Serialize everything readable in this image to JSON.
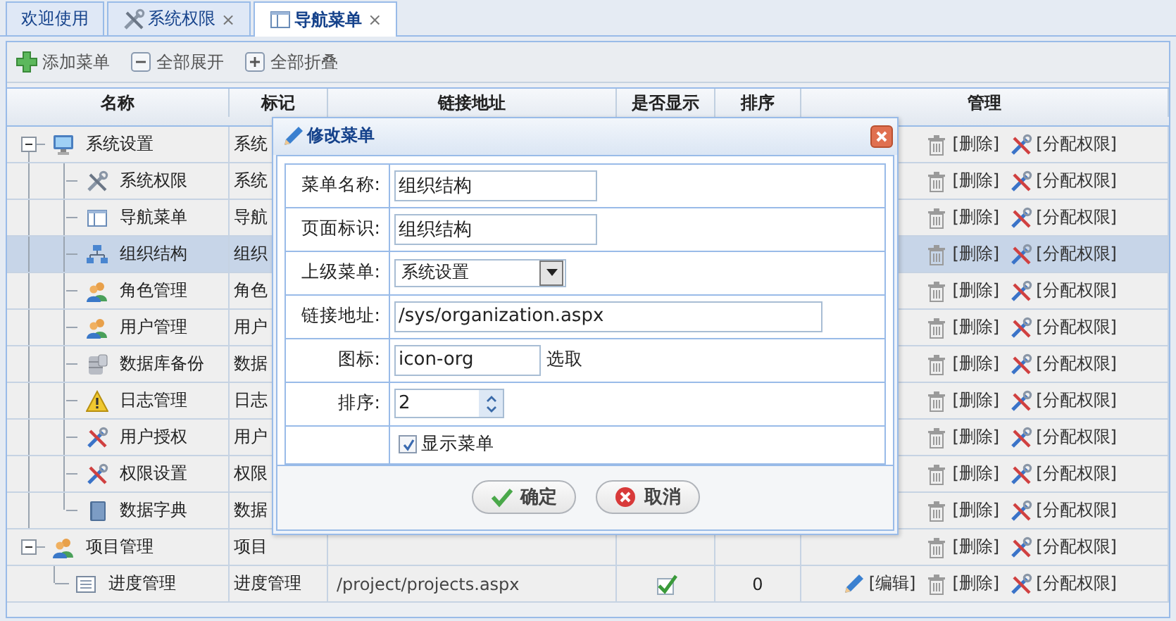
{
  "tabs": [
    {
      "label": "欢迎使用",
      "selected": false
    },
    {
      "label": "系统权限",
      "selected": false,
      "close": "×"
    },
    {
      "label": "导航菜单",
      "selected": true,
      "close": "×"
    }
  ],
  "toolbar": [
    {
      "label": "添加菜单"
    },
    {
      "label": "全部展开"
    },
    {
      "label": "全部折叠"
    }
  ],
  "table": {
    "columns": [
      "名称",
      "标记",
      "链接地址",
      "是否显示",
      "排序",
      "管理"
    ],
    "tree": [
      {
        "name": "系统设置",
        "mark": "系统",
        "expanded": true,
        "selected": false,
        "actions": [
          {
            "kind": "delete",
            "label": "[删除]"
          },
          {
            "kind": "assign",
            "label": "[分配权限]"
          }
        ],
        "children": [
          {
            "name": "系统权限",
            "mark": "系统",
            "selected": false,
            "actions": [
              {
                "kind": "delete",
                "label": "[删除]"
              },
              {
                "kind": "assign",
                "label": "[分配权限]"
              }
            ]
          },
          {
            "name": "导航菜单",
            "mark": "导航",
            "selected": false,
            "actions": [
              {
                "kind": "delete",
                "label": "[删除]"
              },
              {
                "kind": "assign",
                "label": "[分配权限]"
              }
            ]
          },
          {
            "name": "组织结构",
            "mark": "组织",
            "selected": true,
            "actions": [
              {
                "kind": "delete",
                "label": "[删除]"
              },
              {
                "kind": "assign",
                "label": "[分配权限]"
              }
            ]
          },
          {
            "name": "角色管理",
            "mark": "角色",
            "selected": false,
            "actions": [
              {
                "kind": "delete",
                "label": "[删除]"
              },
              {
                "kind": "assign",
                "label": "[分配权限]"
              }
            ]
          },
          {
            "name": "用户管理",
            "mark": "用户",
            "selected": false,
            "actions": [
              {
                "kind": "delete",
                "label": "[删除]"
              },
              {
                "kind": "assign",
                "label": "[分配权限]"
              }
            ]
          },
          {
            "name": "数据库备份",
            "mark": "数据",
            "selected": false,
            "actions": [
              {
                "kind": "delete",
                "label": "[删除]"
              },
              {
                "kind": "assign",
                "label": "[分配权限]"
              }
            ]
          },
          {
            "name": "日志管理",
            "mark": "日志",
            "selected": false,
            "actions": [
              {
                "kind": "delete",
                "label": "[删除]"
              },
              {
                "kind": "assign",
                "label": "[分配权限]"
              }
            ]
          },
          {
            "name": "用户授权",
            "mark": "用户",
            "selected": false,
            "actions": [
              {
                "kind": "delete",
                "label": "[删除]"
              },
              {
                "kind": "assign",
                "label": "[分配权限]"
              }
            ]
          },
          {
            "name": "权限设置",
            "mark": "权限",
            "selected": false,
            "actions": [
              {
                "kind": "delete",
                "label": "[删除]"
              },
              {
                "kind": "assign",
                "label": "[分配权限]"
              }
            ]
          },
          {
            "name": "数据字典",
            "mark": "数据",
            "selected": false,
            "actions": [
              {
                "kind": "delete",
                "label": "[删除]"
              },
              {
                "kind": "assign",
                "label": "[分配权限]"
              }
            ]
          }
        ]
      },
      {
        "name": "项目管理",
        "mark": "项目",
        "expanded": true,
        "selected": false,
        "actions": [
          {
            "kind": "delete",
            "label": "[删除]"
          },
          {
            "kind": "assign",
            "label": "[分配权限]"
          }
        ],
        "children": [
          {
            "name": "进度管理",
            "mark": "进度管理",
            "link": "/project/projects.aspx",
            "shown": true,
            "sort": "0",
            "selected": false,
            "actions": [
              {
                "kind": "edit",
                "label": "[编辑]"
              },
              {
                "kind": "delete",
                "label": "[删除]"
              },
              {
                "kind": "assign",
                "label": "[分配权限]"
              }
            ]
          }
        ]
      }
    ]
  },
  "dialog": {
    "title": "修改菜单",
    "fields": [
      {
        "kind": "text",
        "label": "菜单名称:",
        "value": "组织结构"
      },
      {
        "kind": "text",
        "label": "页面标识:",
        "value": "组织结构"
      },
      {
        "kind": "select",
        "label": "上级菜单:",
        "value": "系统设置"
      },
      {
        "kind": "long",
        "label": "链接地址:",
        "value": "/sys/organization.aspx"
      },
      {
        "kind": "picker",
        "label": "图标:",
        "value": "icon-org",
        "link": "选取"
      },
      {
        "kind": "spinner",
        "label": "排序:",
        "value": "2"
      },
      {
        "kind": "checkbox",
        "option": "显示菜单",
        "checked": true
      }
    ],
    "buttons": [
      {
        "kind": "ok",
        "label": "确定"
      },
      {
        "kind": "cancel",
        "label": "取消"
      }
    ]
  }
}
